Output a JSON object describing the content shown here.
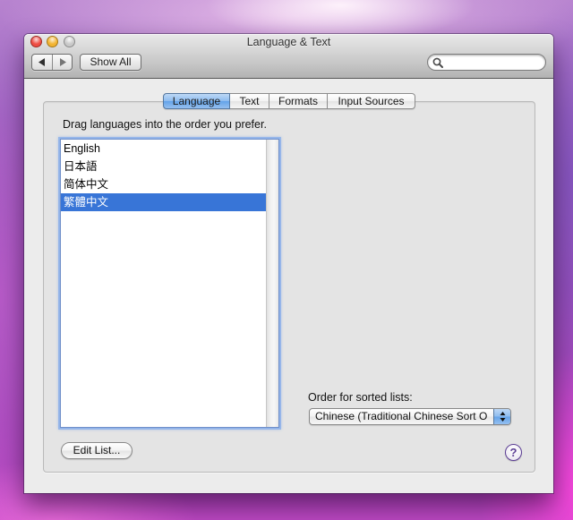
{
  "window": {
    "title": "Language & Text"
  },
  "toolbar": {
    "show_all_label": "Show All",
    "search_value": ""
  },
  "tabs": [
    {
      "label": "Language",
      "selected": true
    },
    {
      "label": "Text",
      "selected": false
    },
    {
      "label": "Formats",
      "selected": false
    },
    {
      "label": "Input Sources",
      "selected": false
    }
  ],
  "language_pane": {
    "instruction": "Drag languages into the order you prefer.",
    "languages": [
      {
        "label": "English",
        "selected": false
      },
      {
        "label": "日本語",
        "selected": false
      },
      {
        "label": "简体中文",
        "selected": false
      },
      {
        "label": "繁體中文",
        "selected": true
      }
    ],
    "sort_order": {
      "label": "Order for sorted lists:",
      "value": "Chinese (Traditional Chinese Sort O"
    },
    "edit_list_label": "Edit List...",
    "help_label": "?"
  },
  "icons": {
    "window_controls": [
      "close-icon",
      "minimize-icon",
      "zoom-icon"
    ],
    "navigation": [
      "back-arrow-icon",
      "forward-arrow-icon"
    ],
    "search": "search-icon",
    "popup": "up-down-arrows-icon"
  },
  "colors": {
    "selection": "#3875d7",
    "selection_text": "#ffffff",
    "aqua_blue": "#5c9ee8",
    "close": "#ee4d43",
    "minimize": "#f2b431",
    "zoom": "#c9c9c9",
    "help_accent": "#5b3d93"
  }
}
